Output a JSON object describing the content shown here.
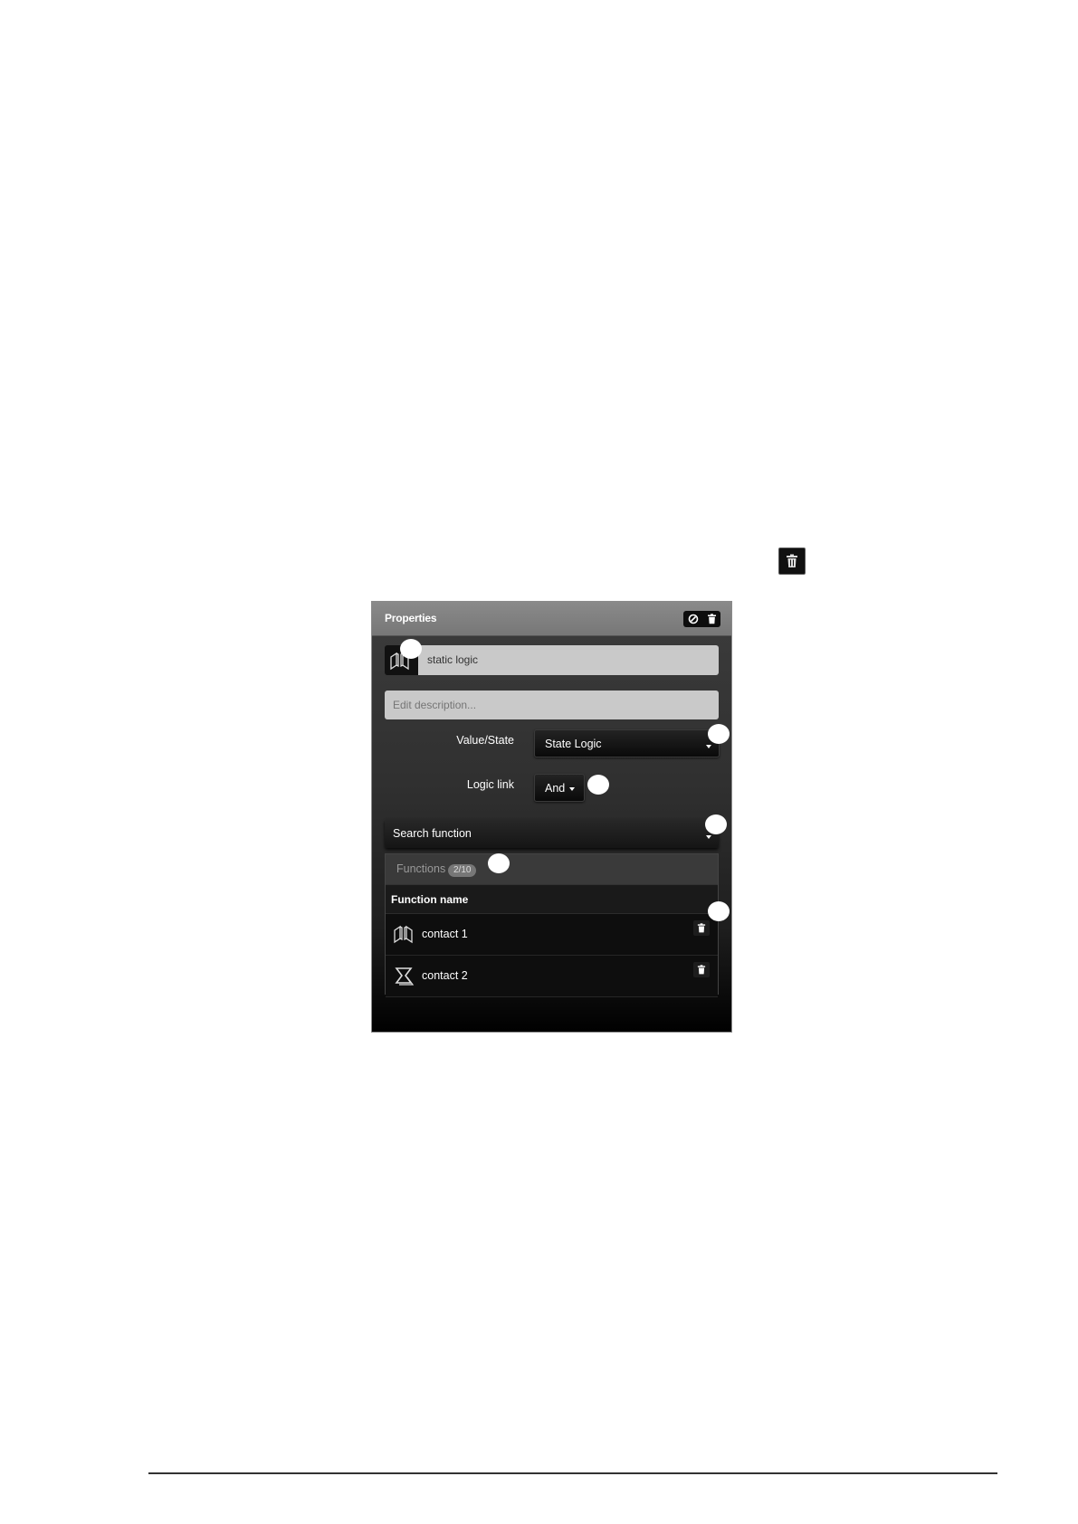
{
  "panel": {
    "title": "Properties",
    "header_icons": [
      "clear-circle-icon",
      "trash-icon"
    ],
    "name_value": "static logic",
    "name_icon": "contact-logic-icon",
    "description_placeholder": "Edit description..."
  },
  "fields": {
    "value_state_label": "Value/State",
    "value_state_selected": "State Logic",
    "logic_link_label": "Logic link",
    "logic_link_selected": "And"
  },
  "search": {
    "label": "Search function"
  },
  "functions": {
    "label": "Functions",
    "count": "2/10",
    "column_header": "Function name",
    "rows": [
      {
        "name": "contact 1",
        "icon": "contact-logic-icon"
      },
      {
        "name": "contact 2",
        "icon": "step-chevron-icon"
      }
    ]
  },
  "colors": {
    "header_gray": "#7f7f7f",
    "input_gray": "#c9c9c9",
    "panel_dark": "#303030"
  }
}
